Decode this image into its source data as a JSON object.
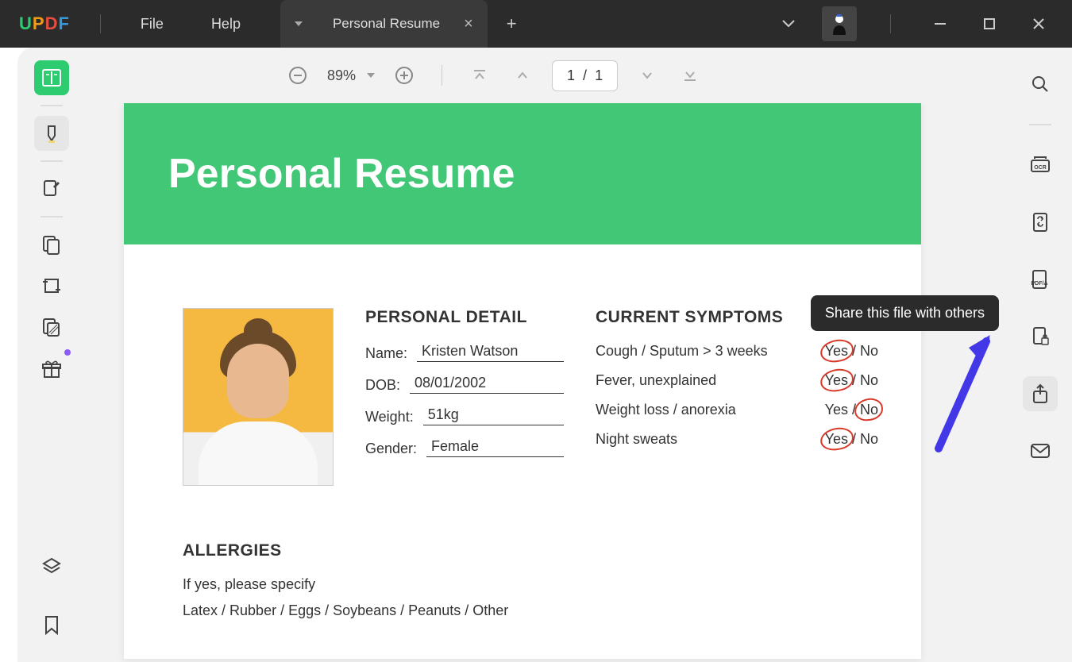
{
  "titlebar": {
    "menu_file": "File",
    "menu_help": "Help",
    "tab_title": "Personal Resume"
  },
  "toolbar": {
    "zoom_level": "89%",
    "page_current": "1",
    "page_sep": "/",
    "page_total": "1"
  },
  "tooltip": {
    "share": "Share this file with others"
  },
  "document": {
    "title": "Personal Resume",
    "personal_detail": {
      "heading": "PERSONAL DETAIL",
      "name_label": "Name:",
      "name_value": "Kristen Watson",
      "dob_label": "DOB:",
      "dob_value": "08/01/2002",
      "weight_label": "Weight:",
      "weight_value": "51kg",
      "gender_label": "Gender:",
      "gender_value": "Female"
    },
    "symptoms": {
      "heading": "CURRENT SYMPTOMS",
      "rows": [
        {
          "label": "Cough / Sputum > 3 weeks",
          "yn": "Yes / No",
          "circled": "yes"
        },
        {
          "label": "Fever, unexplained",
          "yn": "Yes / No",
          "circled": "yes"
        },
        {
          "label": "Weight loss / anorexia",
          "yn": "Yes / No",
          "circled": "no"
        },
        {
          "label": "Night sweats",
          "yn": "Yes / No",
          "circled": "yes"
        }
      ]
    },
    "allergies": {
      "heading": "ALLERGIES",
      "line1": "If yes, please specify",
      "line2": "Latex / Rubber / Eggs / Soybeans / Peanuts / Other"
    }
  }
}
